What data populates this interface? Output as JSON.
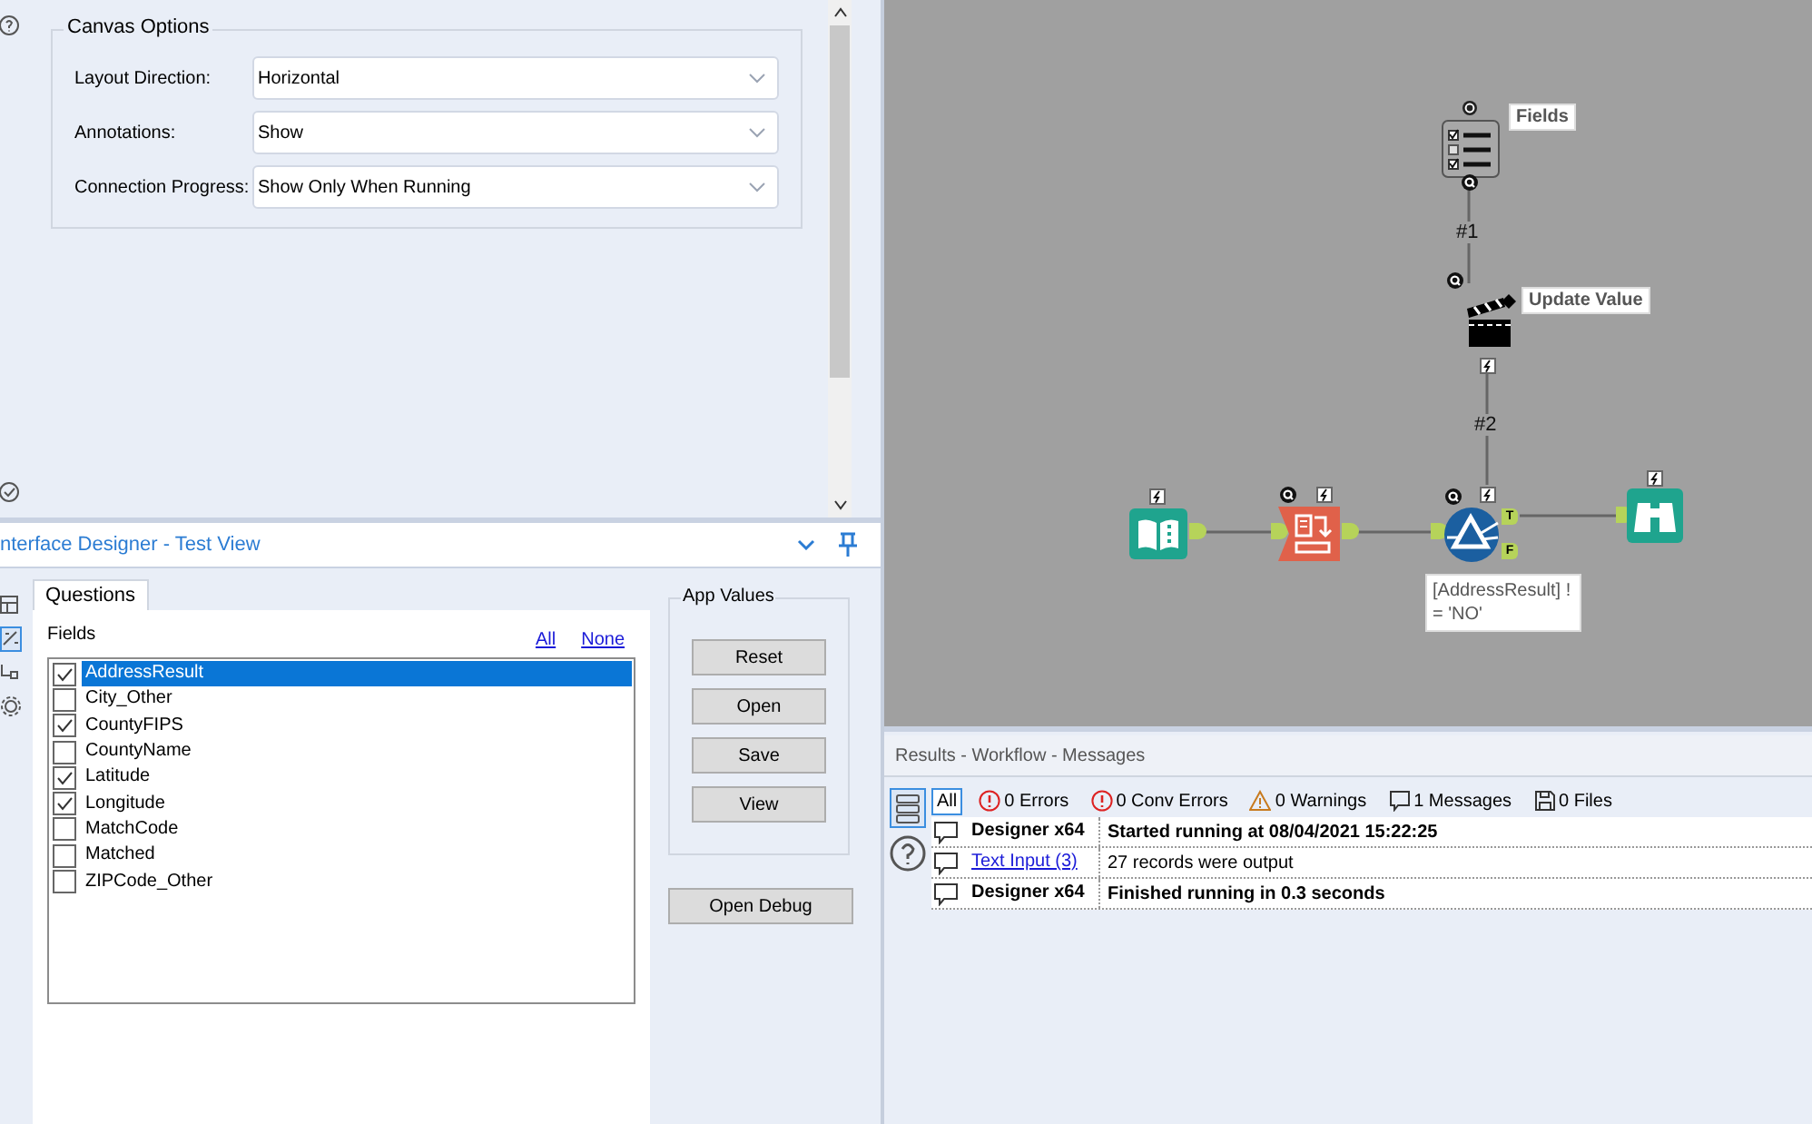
{
  "canvas_options": {
    "title": "Canvas Options",
    "settings": [
      {
        "label": "Layout Direction:",
        "value": "Horizontal"
      },
      {
        "label": "Annotations:",
        "value": "Show"
      },
      {
        "label": "Connection Progress:",
        "value": "Show Only When Running"
      }
    ]
  },
  "interface_designer": {
    "title": "nterface Designer - Test View",
    "tabs": [
      {
        "label": "Questions",
        "selected": true
      }
    ],
    "fields_label": "Fields",
    "links": [
      "All",
      "None"
    ],
    "fields": [
      {
        "name": "AddressResult",
        "checked": true,
        "selected": true
      },
      {
        "name": "City_Other",
        "checked": false,
        "selected": false
      },
      {
        "name": "CountyFIPS",
        "checked": true,
        "selected": false
      },
      {
        "name": "CountyName",
        "checked": false,
        "selected": false
      },
      {
        "name": "Latitude",
        "checked": true,
        "selected": false
      },
      {
        "name": "Longitude",
        "checked": true,
        "selected": false
      },
      {
        "name": "MatchCode",
        "checked": false,
        "selected": false
      },
      {
        "name": "Matched",
        "checked": false,
        "selected": false
      },
      {
        "name": "ZIPCode_Other",
        "checked": false,
        "selected": false
      }
    ],
    "app_values": {
      "title": "App Values",
      "buttons": [
        "Reset",
        "Open",
        "Save",
        "View"
      ]
    },
    "debug_button": "Open Debug"
  },
  "workflow": {
    "nodes": [
      {
        "kind": "checklist",
        "label": "Fields"
      },
      {
        "kind": "clapper",
        "label": "Update Value"
      },
      {
        "kind": "input"
      },
      {
        "kind": "formula"
      },
      {
        "kind": "filter",
        "annotation": [
          "[AddressResult] !",
          "= 'NO'"
        ],
        "ports": [
          "T",
          "F"
        ]
      },
      {
        "kind": "browse"
      }
    ],
    "connections": [
      {
        "label": "#1"
      },
      {
        "label": "#2"
      }
    ]
  },
  "results": {
    "title": "Results - Workflow - Messages",
    "filters": [
      {
        "kind": "all",
        "label": "All",
        "selected": true
      },
      {
        "kind": "error",
        "label": "0 Errors",
        "selected": false
      },
      {
        "kind": "error",
        "label": "0 Conv Errors",
        "selected": false
      },
      {
        "kind": "warning",
        "label": "0 Warnings",
        "selected": false
      },
      {
        "kind": "message",
        "label": "1 Messages",
        "selected": false
      },
      {
        "kind": "file",
        "label": "0 Files",
        "selected": false
      }
    ],
    "messages": [
      {
        "source": "Designer x64",
        "link": false,
        "text": "Started running at 08/04/2021 15:22:25",
        "bold": true
      },
      {
        "source": "Text Input (3)",
        "link": true,
        "text": "27 records were output",
        "bold": false
      },
      {
        "source": "Designer x64",
        "link": false,
        "text": "Finished running in 0.3 seconds",
        "bold": true
      }
    ]
  }
}
